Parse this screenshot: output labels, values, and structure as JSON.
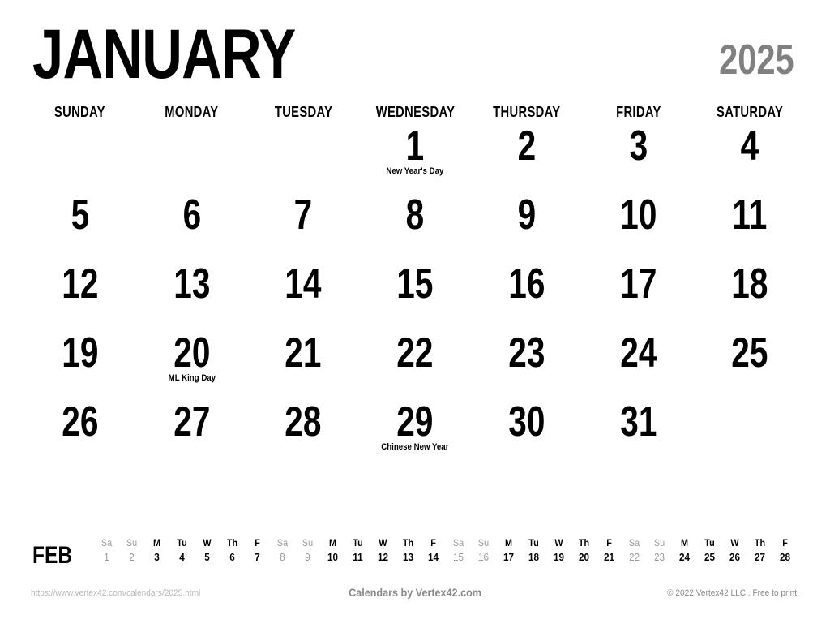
{
  "header": {
    "month": "JANUARY",
    "year": "2025",
    "year_color": "#808080"
  },
  "weekday_headers": [
    "SUNDAY",
    "MONDAY",
    "TUESDAY",
    "WEDNESDAY",
    "THURSDAY",
    "FRIDAY",
    "SATURDAY"
  ],
  "weeks": [
    [
      {
        "num": "",
        "note": ""
      },
      {
        "num": "",
        "note": ""
      },
      {
        "num": "",
        "note": ""
      },
      {
        "num": "1",
        "note": "New Year's Day"
      },
      {
        "num": "2",
        "note": ""
      },
      {
        "num": "3",
        "note": ""
      },
      {
        "num": "4",
        "note": ""
      }
    ],
    [
      {
        "num": "5",
        "note": ""
      },
      {
        "num": "6",
        "note": ""
      },
      {
        "num": "7",
        "note": ""
      },
      {
        "num": "8",
        "note": ""
      },
      {
        "num": "9",
        "note": ""
      },
      {
        "num": "10",
        "note": ""
      },
      {
        "num": "11",
        "note": ""
      }
    ],
    [
      {
        "num": "12",
        "note": ""
      },
      {
        "num": "13",
        "note": ""
      },
      {
        "num": "14",
        "note": ""
      },
      {
        "num": "15",
        "note": ""
      },
      {
        "num": "16",
        "note": ""
      },
      {
        "num": "17",
        "note": ""
      },
      {
        "num": "18",
        "note": ""
      }
    ],
    [
      {
        "num": "19",
        "note": ""
      },
      {
        "num": "20",
        "note": "ML King Day"
      },
      {
        "num": "21",
        "note": ""
      },
      {
        "num": "22",
        "note": ""
      },
      {
        "num": "23",
        "note": ""
      },
      {
        "num": "24",
        "note": ""
      },
      {
        "num": "25",
        "note": ""
      }
    ],
    [
      {
        "num": "26",
        "note": ""
      },
      {
        "num": "27",
        "note": ""
      },
      {
        "num": "28",
        "note": ""
      },
      {
        "num": "29",
        "note": "Chinese New Year"
      },
      {
        "num": "30",
        "note": ""
      },
      {
        "num": "31",
        "note": ""
      },
      {
        "num": "",
        "note": ""
      }
    ]
  ],
  "mini_calendar": {
    "label": "FEB",
    "weekend_color": "#9a9a9a",
    "days": [
      {
        "dow": "Sa",
        "num": "1",
        "weekend": true
      },
      {
        "dow": "Su",
        "num": "2",
        "weekend": true
      },
      {
        "dow": "M",
        "num": "3",
        "weekend": false
      },
      {
        "dow": "Tu",
        "num": "4",
        "weekend": false
      },
      {
        "dow": "W",
        "num": "5",
        "weekend": false
      },
      {
        "dow": "Th",
        "num": "6",
        "weekend": false
      },
      {
        "dow": "F",
        "num": "7",
        "weekend": false
      },
      {
        "dow": "Sa",
        "num": "8",
        "weekend": true
      },
      {
        "dow": "Su",
        "num": "9",
        "weekend": true
      },
      {
        "dow": "M",
        "num": "10",
        "weekend": false
      },
      {
        "dow": "Tu",
        "num": "11",
        "weekend": false
      },
      {
        "dow": "W",
        "num": "12",
        "weekend": false
      },
      {
        "dow": "Th",
        "num": "13",
        "weekend": false
      },
      {
        "dow": "F",
        "num": "14",
        "weekend": false
      },
      {
        "dow": "Sa",
        "num": "15",
        "weekend": true
      },
      {
        "dow": "Su",
        "num": "16",
        "weekend": true
      },
      {
        "dow": "M",
        "num": "17",
        "weekend": false
      },
      {
        "dow": "Tu",
        "num": "18",
        "weekend": false
      },
      {
        "dow": "W",
        "num": "19",
        "weekend": false
      },
      {
        "dow": "Th",
        "num": "20",
        "weekend": false
      },
      {
        "dow": "F",
        "num": "21",
        "weekend": false
      },
      {
        "dow": "Sa",
        "num": "22",
        "weekend": true
      },
      {
        "dow": "Su",
        "num": "23",
        "weekend": true
      },
      {
        "dow": "M",
        "num": "24",
        "weekend": false
      },
      {
        "dow": "Tu",
        "num": "25",
        "weekend": false
      },
      {
        "dow": "W",
        "num": "26",
        "weekend": false
      },
      {
        "dow": "Th",
        "num": "27",
        "weekend": false
      },
      {
        "dow": "F",
        "num": "28",
        "weekend": false
      }
    ]
  },
  "footer": {
    "url": "https://www.vertex42.com/calendars/2025.html",
    "center": "Calendars by Vertex42.com",
    "copyright": "© 2022 Vertex42 LLC . Free to print."
  }
}
